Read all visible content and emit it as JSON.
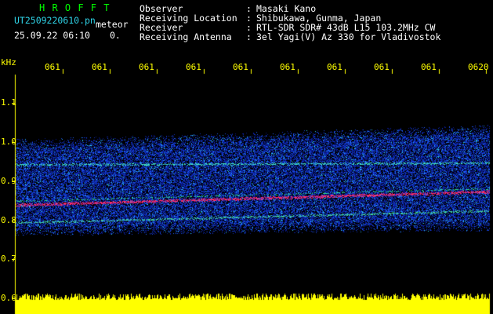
{
  "header": {
    "brand": "H R O F F T",
    "filename": "UT2509220610.pn",
    "mode": "meteor",
    "datetime": "25.09.22 06:10",
    "count": "0.",
    "fields": [
      {
        "label": "Observer",
        "value": "Masaki Kano"
      },
      {
        "label": "Receiving Location",
        "value": "Shibukawa, Gunma, Japan"
      },
      {
        "label": "Receiver",
        "value": "RTL-SDR SDR# 43dB L15 103.2MHz CW"
      },
      {
        "label": "Receiving Antenna",
        "value": "3el Yagi(V) Az 330 for Vladivostok"
      }
    ],
    "separator": ":"
  },
  "axes": {
    "freq_unit": "kHz",
    "freq_ticks": [
      "1.1",
      "1.0",
      "0.9",
      "0.8",
      "0.7",
      "0.6"
    ],
    "time_ticks": [
      "061",
      "061",
      "061",
      "061",
      "061",
      "061",
      "061",
      "061",
      "061",
      "0620"
    ]
  },
  "colors": {
    "brand": "#00ff00",
    "filename": "#2fd2e6",
    "header_text": "#ffffff",
    "axis": "#ffff00",
    "background": "#000000"
  }
}
